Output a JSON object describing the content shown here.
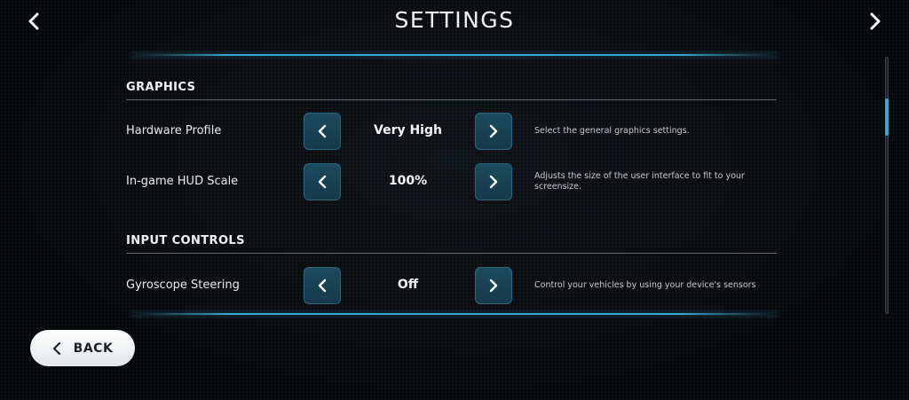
{
  "header": {
    "title": "SETTINGS",
    "prev_icon": "chevron-left-icon",
    "next_icon": "chevron-right-icon"
  },
  "sections": [
    {
      "title": "GRAPHICS",
      "rows": [
        {
          "label": "Hardware Profile",
          "value": "Very High",
          "description": "Select the general graphics settings."
        },
        {
          "label": "In-game HUD Scale",
          "value": "100%",
          "description": "Adjusts the size of the user interface to fit to your screensize."
        }
      ]
    },
    {
      "title": "INPUT CONTROLS",
      "rows": [
        {
          "label": "Gyroscope Steering",
          "value": "Off",
          "description": "Control your vehicles by using your device's sensors"
        }
      ]
    }
  ],
  "back_button": {
    "label": "BACK",
    "icon": "chevron-left-icon"
  },
  "colors": {
    "accent": "#3aa6cc",
    "button_bg": "#1c4a5e",
    "background": "#07090b"
  }
}
